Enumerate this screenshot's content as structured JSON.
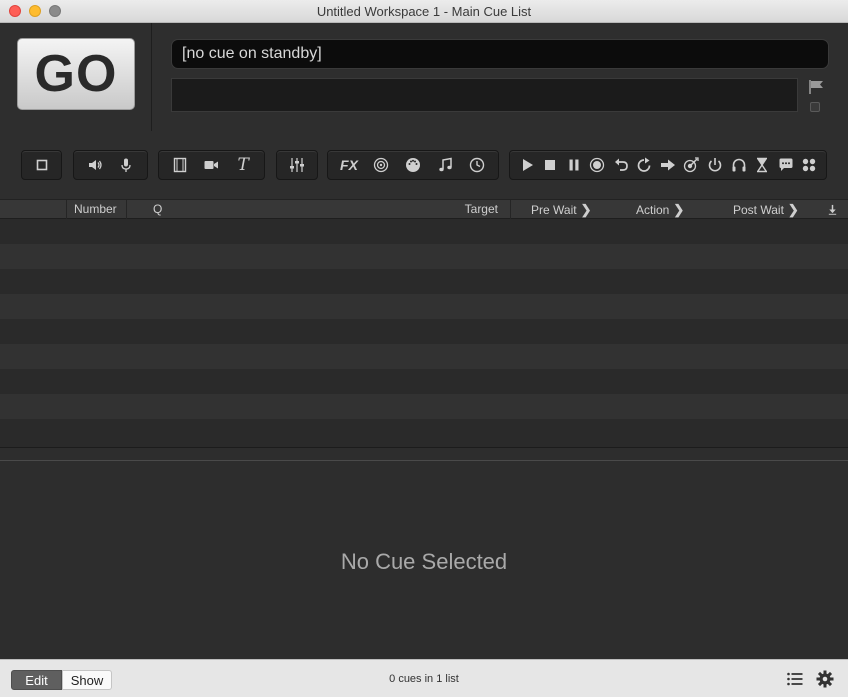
{
  "window": {
    "title": "Untitled Workspace 1 - Main Cue List"
  },
  "header": {
    "go_label": "GO",
    "standby_text": "[no cue on standby]",
    "notes_value": ""
  },
  "toolbar": {
    "groups": [
      {
        "name": "group",
        "buttons": [
          "group-icon"
        ]
      },
      {
        "name": "audio",
        "buttons": [
          "speaker-icon",
          "microphone-icon"
        ]
      },
      {
        "name": "video",
        "buttons": [
          "film-icon",
          "camera-icon",
          "text-icon"
        ]
      },
      {
        "name": "fade",
        "buttons": [
          "fader-icon"
        ]
      },
      {
        "name": "control",
        "buttons": [
          "fx-icon",
          "target-icon",
          "midi-icon",
          "music-note-icon",
          "clock-icon"
        ]
      },
      {
        "name": "transport",
        "buttons": [
          "play-icon",
          "stop-icon",
          "pause-icon",
          "record-icon",
          "undo-icon",
          "redo-icon",
          "arrow-right-icon",
          "dart-icon",
          "power-icon",
          "headphones-icon",
          "hourglass-icon",
          "speech-bubble-icon",
          "grid-icon"
        ]
      }
    ],
    "fx_label": "FX",
    "text_label": "T"
  },
  "columns": {
    "number": "Number",
    "q": "Q",
    "target": "Target",
    "pre_wait": "Pre Wait",
    "action": "Action",
    "post_wait": "Post Wait"
  },
  "inspector": {
    "empty_text": "No Cue Selected"
  },
  "footer": {
    "edit_label": "Edit",
    "show_label": "Show",
    "status": "0 cues in 1 list"
  },
  "colors": {
    "background": "#2b2b2b",
    "go_button": "#e0e0e0",
    "close": "#fe5f57",
    "minimize": "#febc2e"
  }
}
